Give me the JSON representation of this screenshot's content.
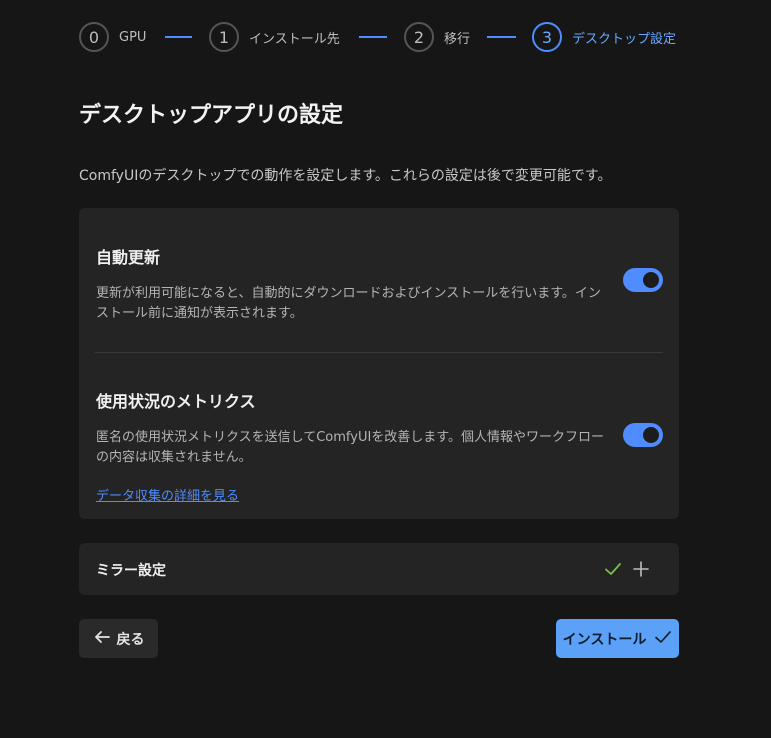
{
  "stepper": {
    "steps": [
      {
        "number": "0",
        "label": "GPU"
      },
      {
        "number": "1",
        "label": "インストール先"
      },
      {
        "number": "2",
        "label": "移行"
      },
      {
        "number": "3",
        "label": "デスクトップ設定"
      }
    ],
    "active_step": 3
  },
  "page": {
    "title": "デスクトップアプリの設定",
    "subtitle": "ComfyUIのデスクトップでの動作を設定します。これらの設定は後で変更可能です。"
  },
  "settings": {
    "auto_update": {
      "title": "自動更新",
      "description": "更新が利用可能になると、自動的にダウンロードおよびインストールを行います。インストール前に通知が表示されます。",
      "enabled": true
    },
    "metrics": {
      "title": "使用状況のメトリクス",
      "description": "匿名の使用状況メトリクスを送信してComfyUIを改善します。個人情報やワークフローの内容は収集されません。",
      "enabled": true,
      "link": "データ収集の詳細を見る"
    }
  },
  "mirror": {
    "label": "ミラー設定",
    "icons": [
      "check-icon",
      "plus-icon"
    ]
  },
  "actions": {
    "back_label": "戻る",
    "install_label": "インストール"
  },
  "colors": {
    "accent": "#4e8cff",
    "install_button": "#5aa1f7",
    "check": "#7bbf4a",
    "background": "#161616",
    "card": "#242424"
  }
}
